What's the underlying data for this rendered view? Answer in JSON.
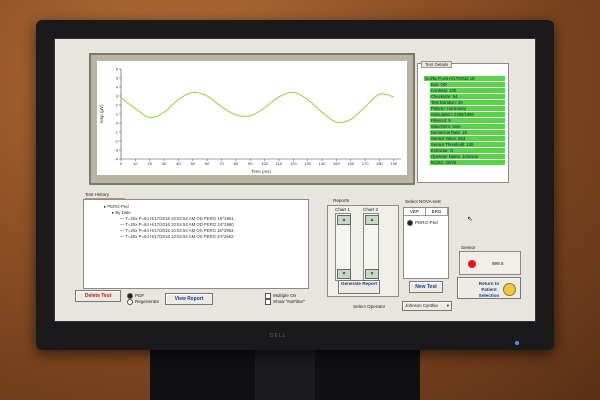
{
  "scene": {
    "monitor_brand": "DELL"
  },
  "chart_data": {
    "type": "line",
    "title": "",
    "xlabel": "Time (ms)",
    "ylabel": "Amp (µV)",
    "x_ticks": [
      0,
      10,
      20,
      30,
      40,
      50,
      60,
      70,
      80,
      90,
      100,
      110,
      120,
      130,
      140,
      150,
      160,
      170,
      180,
      190
    ],
    "y_ticks": [
      -4,
      -3,
      -2,
      -1,
      0,
      1,
      2,
      3,
      4,
      5,
      6
    ],
    "xlim": [
      0,
      195
    ],
    "ylim": [
      -4,
      6
    ],
    "series": [
      {
        "color": "#9ad64a",
        "x": [
          0,
          10,
          20,
          30,
          40,
          50,
          60,
          70,
          80,
          90,
          100,
          110,
          120,
          130,
          140,
          150,
          160,
          170,
          180,
          190
        ],
        "y": [
          2.8,
          1.6,
          0.6,
          1.2,
          2.6,
          3.4,
          3.0,
          1.8,
          0.9,
          0.8,
          1.7,
          2.9,
          3.4,
          2.6,
          1.2,
          0.1,
          0.4,
          1.8,
          3.2,
          2.9
        ]
      }
    ]
  },
  "test_details": {
    "group_label": "Test Details",
    "root": "S=25x P=64 H/17/2016 10:",
    "items": [
      "Eye: OD",
      "Contrast: 100",
      "Checksize: 64",
      "Test Duration: 20",
      "Pattern: Horizontal",
      "Stimulation: 2400/1000",
      "Filtercut: 5",
      "Waveform: Sine",
      "Numerical Rate: 15",
      "Sensor Value: 853",
      "Sensor Threshold: 130",
      "Extractor: N",
      "Operator Name: Johnson",
      "NCMA: 20/20"
    ]
  },
  "test_history": {
    "label": "Test History",
    "root": "PERG-Ped",
    "group": "By Date",
    "entries": [
      "T=25x P=64 H/17/2016 10:04:54 AM OD PERG 16^2961",
      "T=25x P=64 H/17/2016 10:04:54 AM OD PERG 24^2960",
      "T=25x P=64 H/17/2016 10:04:54 AM OS PERG 16^2963",
      "T=25x P=64 H/17/2016 10:04:54 AM OS PERG 24^2962"
    ]
  },
  "actions": {
    "delete_test": "Delete Test",
    "pdf": "PDF",
    "regenerate": "Regenerate",
    "view_report": "View Report",
    "multiple_on": "Multiple On",
    "show_nofilter": "Show \"NoFilter\""
  },
  "reports": {
    "label": "Reports",
    "chart1": "Chart 1",
    "chart2": "Chart 2",
    "generate_report": "Generate Report"
  },
  "nova": {
    "label": "Select NOVA-test",
    "tab_vep": "VEP",
    "tab_erg": "ERG",
    "option": "PERG-Ped",
    "new_test": "New Test"
  },
  "sensor": {
    "label": "Sensor",
    "value": "999.5",
    "status_color": "#e01818"
  },
  "operator": {
    "label": "Select Operator",
    "value": "Johnson Cynthia"
  },
  "return_button": "Return to Patient Selection"
}
